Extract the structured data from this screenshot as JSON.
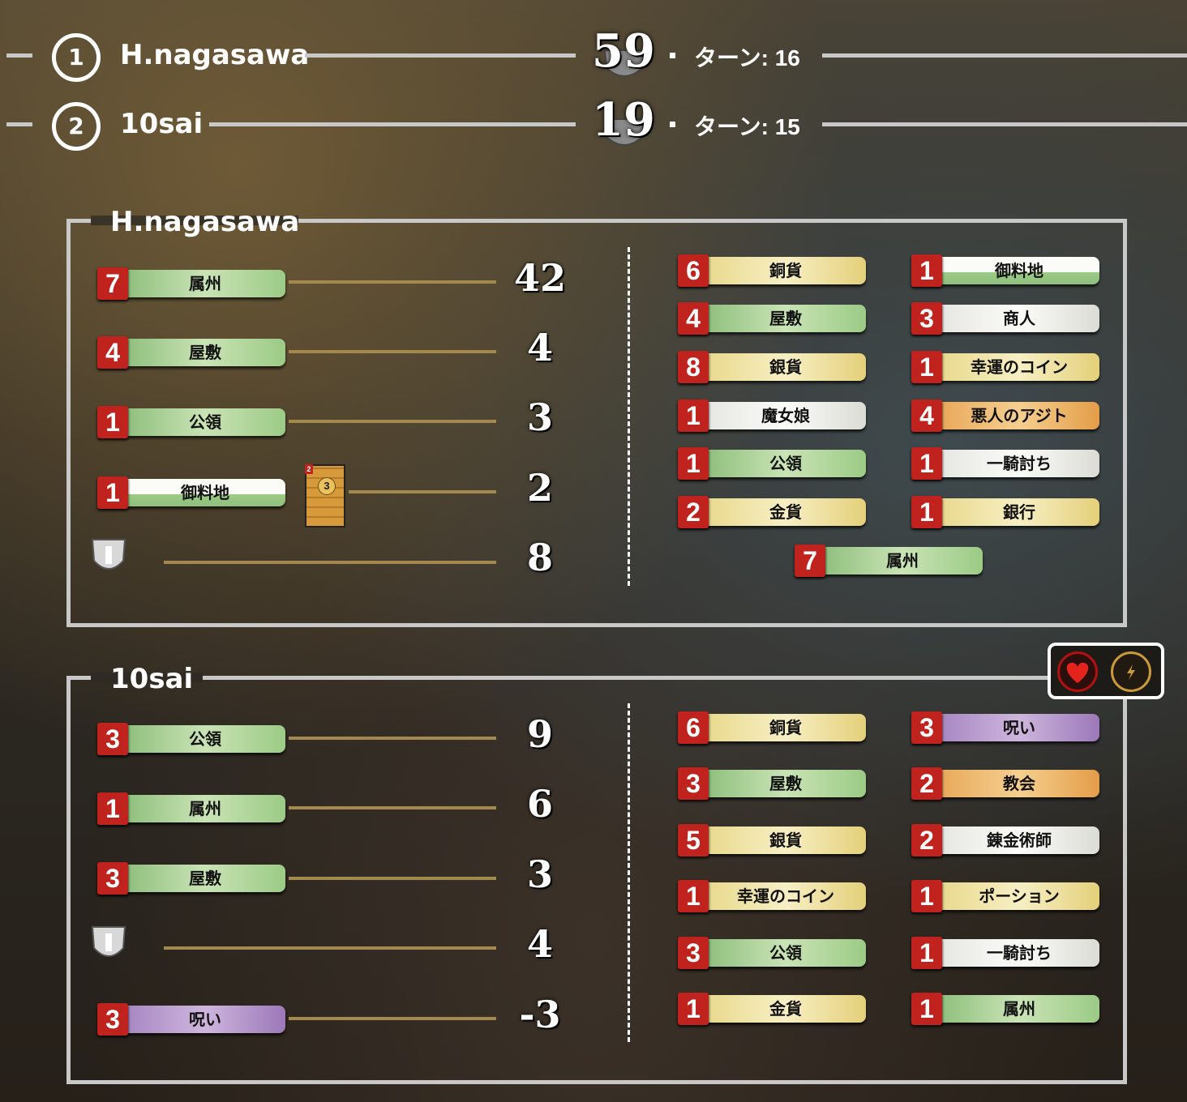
{
  "ranking": [
    {
      "rank": "1",
      "name": "H.nagasawa",
      "score": "59",
      "turn": "ターン: 16"
    },
    {
      "rank": "2",
      "name": "10sai",
      "score": "19",
      "turn": "ターン: 15"
    }
  ],
  "players": [
    {
      "name": "H.nagasawa",
      "vp_rows": [
        {
          "count": "7",
          "label": "属州",
          "color": "green",
          "vp": "42"
        },
        {
          "count": "4",
          "label": "屋敷",
          "color": "green",
          "vp": "4"
        },
        {
          "count": "1",
          "label": "公領",
          "color": "green",
          "vp": "3"
        },
        {
          "count": "1",
          "label": "御料地",
          "color": "white-green",
          "vp": "2",
          "card_cost": "3",
          "card_badge": "2"
        },
        {
          "label": "",
          "vp": "8",
          "shield": true
        }
      ],
      "deck_left": [
        {
          "count": "6",
          "label": "銅貨",
          "color": "yellow"
        },
        {
          "count": "4",
          "label": "屋敷",
          "color": "green"
        },
        {
          "count": "8",
          "label": "銀貨",
          "color": "yellow"
        },
        {
          "count": "1",
          "label": "魔女娘",
          "color": "white"
        },
        {
          "count": "1",
          "label": "公領",
          "color": "green"
        },
        {
          "count": "2",
          "label": "金貨",
          "color": "yellow"
        }
      ],
      "deck_right": [
        {
          "count": "1",
          "label": "御料地",
          "color": "white-green"
        },
        {
          "count": "3",
          "label": "商人",
          "color": "white"
        },
        {
          "count": "1",
          "label": "幸運のコイン",
          "color": "yellow"
        },
        {
          "count": "4",
          "label": "悪人のアジト",
          "color": "orange"
        },
        {
          "count": "1",
          "label": "一騎討ち",
          "color": "white"
        },
        {
          "count": "1",
          "label": "銀行",
          "color": "yellow"
        }
      ],
      "deck_extra": {
        "count": "7",
        "label": "属州",
        "color": "green"
      }
    },
    {
      "name": "10sai",
      "vp_rows": [
        {
          "count": "3",
          "label": "公領",
          "color": "green",
          "vp": "9"
        },
        {
          "count": "1",
          "label": "属州",
          "color": "green",
          "vp": "6"
        },
        {
          "count": "3",
          "label": "屋敷",
          "color": "green",
          "vp": "3"
        },
        {
          "label": "",
          "vp": "4",
          "shield": true
        },
        {
          "count": "3",
          "label": "呪い",
          "color": "purple",
          "vp": "-3"
        }
      ],
      "deck_left": [
        {
          "count": "6",
          "label": "銅貨",
          "color": "yellow"
        },
        {
          "count": "3",
          "label": "屋敷",
          "color": "green"
        },
        {
          "count": "5",
          "label": "銀貨",
          "color": "yellow"
        },
        {
          "count": "1",
          "label": "幸運のコイン",
          "color": "yellow"
        },
        {
          "count": "3",
          "label": "公領",
          "color": "green"
        },
        {
          "count": "1",
          "label": "金貨",
          "color": "yellow"
        }
      ],
      "deck_right": [
        {
          "count": "3",
          "label": "呪い",
          "color": "purple"
        },
        {
          "count": "2",
          "label": "教会",
          "color": "orange"
        },
        {
          "count": "2",
          "label": "錬金術師",
          "color": "white"
        },
        {
          "count": "1",
          "label": "ポーション",
          "color": "yellow"
        },
        {
          "count": "1",
          "label": "一騎討ち",
          "color": "white"
        },
        {
          "count": "1",
          "label": "属州",
          "color": "green"
        }
      ],
      "status_icons": [
        "heart-icon",
        "lightning-icon"
      ]
    }
  ],
  "colors": {
    "count_badge": "#c0221d",
    "frame": "#c8c8c8",
    "vp_line": "#a3894d"
  }
}
